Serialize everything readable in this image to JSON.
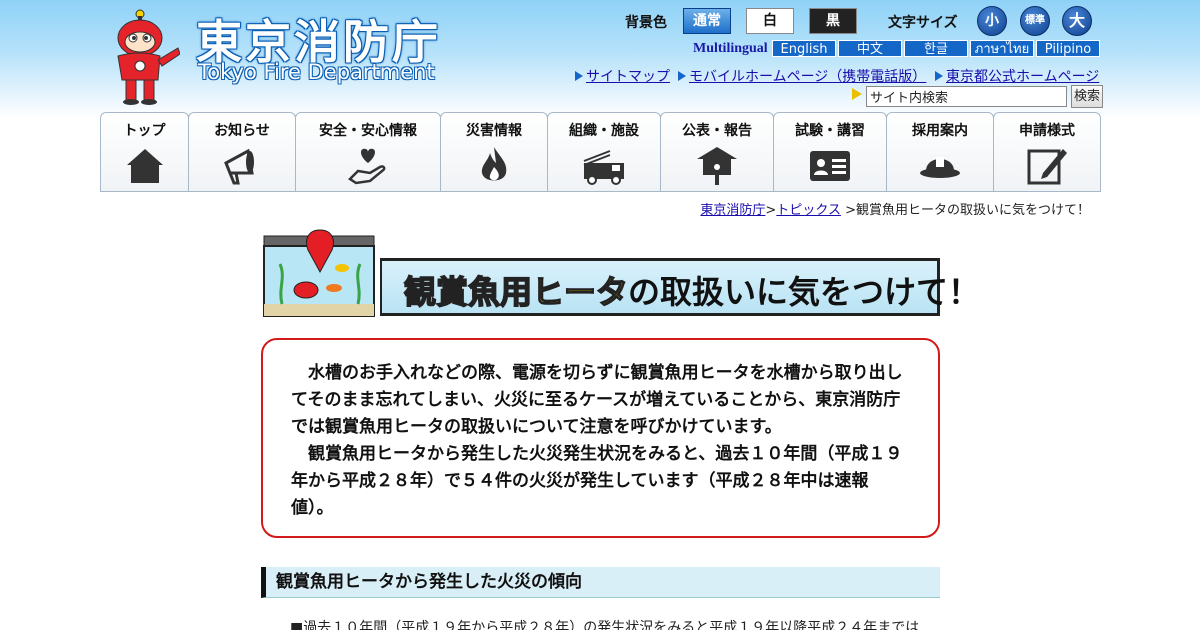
{
  "header": {
    "logo_jp": "東京消防庁",
    "logo_en": "Tokyo Fire Department",
    "bg_color_label": "背景色",
    "bg_buttons": [
      "通常",
      "白",
      "黒"
    ],
    "font_size_label": "文字サイズ",
    "font_size_buttons": [
      "小",
      "標準",
      "大"
    ],
    "multilingual_label": "Multilingual",
    "languages": [
      "English",
      "中文",
      "한글",
      "ภาษาไทย",
      "Pilipino"
    ],
    "links": [
      "サイトマップ",
      "モバイルホームページ（携帯電話版）",
      "東京都公式ホームページ"
    ],
    "search_value": "サイト内検索",
    "search_button": "検索"
  },
  "nav": {
    "items": [
      {
        "label": "トップ",
        "icon": "house-icon"
      },
      {
        "label": "お知らせ",
        "icon": "megaphone-icon"
      },
      {
        "label": "安全・安心情報",
        "icon": "heart-hand-icon"
      },
      {
        "label": "災害情報",
        "icon": "flame-icon"
      },
      {
        "label": "組織・施設",
        "icon": "fire-truck-icon"
      },
      {
        "label": "公表・報告",
        "icon": "notice-board-icon"
      },
      {
        "label": "試験・講習",
        "icon": "id-card-icon"
      },
      {
        "label": "採用案内",
        "icon": "firefighter-helmet-icon"
      },
      {
        "label": "申請様式",
        "icon": "form-edit-icon"
      }
    ]
  },
  "breadcrumb": {
    "home": "東京消防庁",
    "sep1": ">",
    "topics": "トピックス",
    "current": ">観賞魚用ヒータの取扱いに気をつけて！"
  },
  "banner": {
    "highlight": "観賞魚用ヒータ",
    "rest": "の取扱いに気をつけて！"
  },
  "notice": {
    "para1": "水槽のお手入れなどの際、電源を切らずに観賞魚用ヒータを水槽から取り出してそのまま忘れてしまい、火災に至るケースが増えていることから、東京消防庁では観賞魚用ヒータの取扱いについて注意を呼びかけています。",
    "para2": "観賞魚用ヒータから発生した火災発生状況をみると、過去１０年間（平成１９年から平成２８年）で５４件の火災が発生しています（平成２８年中は速報値）。"
  },
  "section": {
    "heading": "観賞魚用ヒータから発生した火災の傾向",
    "first_line": "■過去１０年間（平成１９年から平成２８年）の発生状況をみると平成１９年以降平成２４年までは"
  },
  "colors": {
    "accent_blue": "#1466c7",
    "notice_border": "#d21a1a",
    "banner_yellow": "#f3d600"
  }
}
